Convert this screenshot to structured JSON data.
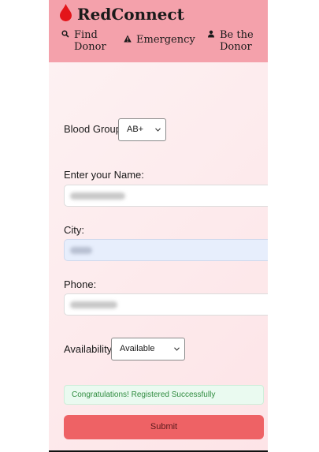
{
  "app": {
    "brand": "RedConnect",
    "brand_color": "#f4a1ab",
    "accent": "#ee6265"
  },
  "nav": [
    {
      "icon": "search-icon",
      "label": "Find Donor"
    },
    {
      "icon": "warning-icon",
      "label": "Emergency"
    },
    {
      "icon": "person-icon",
      "label": "Be the Donor"
    }
  ],
  "form": {
    "blood_group_label": "Blood Group:",
    "blood_group_value": "AB+",
    "name_label": "Enter your Name:",
    "city_label": "City:",
    "phone_label": "Phone:",
    "availability_label": "Availability:",
    "availability_value": "Available",
    "success_message": "Congratulations! Registered Successfully",
    "submit_label": "Submit"
  }
}
